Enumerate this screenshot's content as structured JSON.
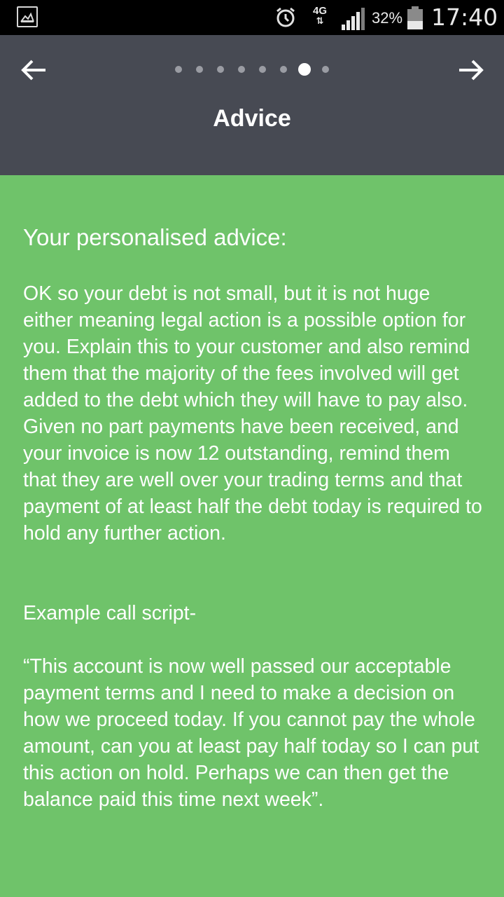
{
  "status_bar": {
    "battery_percent": "32%",
    "network": "4G",
    "time": "17:40",
    "icons": [
      "gallery-icon",
      "alarm-icon",
      "network-4g-icon",
      "signal-icon",
      "battery-icon"
    ]
  },
  "header": {
    "title": "Advice",
    "back_icon": "arrow-left-icon",
    "next_icon": "arrow-right-icon",
    "pager": {
      "total": 8,
      "active": 7
    }
  },
  "content": {
    "heading": "Your personalised advice:",
    "advice": "OK so your debt is not small, but it is not huge either meaning legal action is a possible option for you.  Explain this to your customer and also remind them that the majority of the fees involved will get added to the debt which they will have to pay also.  Given no part payments have been received, and your invoice is now 12 outstanding, remind them that they are well over your trading terms and that payment of at least half the debt today is required to hold any further action.",
    "script_heading": "Example call script-",
    "script": "“This account is now well passed our acceptable payment terms and I need to make a decision on how we proceed today.  If you cannot pay the whole amount, can you at least pay half today so I can put this action on hold.  Perhaps we can then get the balance paid this time next week”."
  },
  "colors": {
    "status_bar": "#000000",
    "header": "#474a53",
    "background": "#6fc36a",
    "text": "#ffffff"
  }
}
